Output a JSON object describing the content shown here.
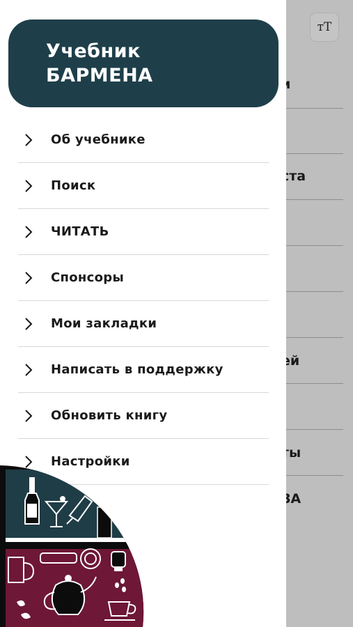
{
  "background": {
    "fragments": [
      "и",
      "ста",
      "ей",
      "ты",
      "ЗА"
    ],
    "font_size_button": "тТ"
  },
  "drawer": {
    "header": {
      "line1": "Учебник",
      "line2": "БАРМЕНА"
    },
    "menu": [
      {
        "label": "Об учебнике",
        "icon": "chevron-right-icon"
      },
      {
        "label": "Поиск",
        "icon": "chevron-right-icon"
      },
      {
        "label": "ЧИТАТЬ",
        "icon": "chevron-right-icon"
      },
      {
        "label": "Спонсоры",
        "icon": "chevron-right-icon"
      },
      {
        "label": "Мои закладки",
        "icon": "chevron-right-icon"
      },
      {
        "label": "Написать в поддержку",
        "icon": "chevron-right-icon"
      },
      {
        "label": "Обновить книгу",
        "icon": "chevron-right-icon"
      },
      {
        "label": "Настройки",
        "icon": "chevron-right-icon"
      }
    ]
  },
  "colors": {
    "header_bg": "#1e3f4a",
    "illustration_teal": "#1f3d47",
    "illustration_burgundy": "#6e1737"
  }
}
